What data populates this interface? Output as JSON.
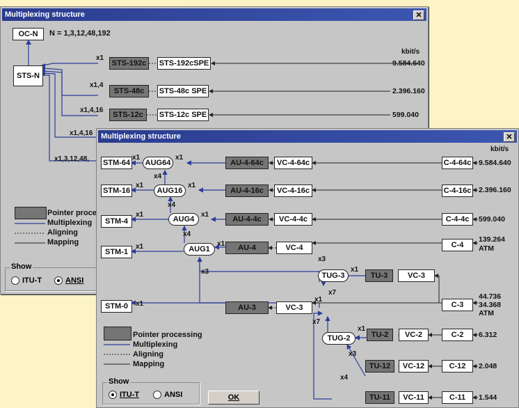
{
  "back": {
    "title": "Multiplexing structure",
    "ocn": "OC-N",
    "n_values": "N = 1,3,12,48,192",
    "stsn": "STS-N",
    "kbits": "kbit/s",
    "rows": [
      {
        "mult": "x1",
        "sts": "STS-192c",
        "spe": "STS-192cSPE",
        "rate": "9.584.640"
      },
      {
        "mult": "x1,4",
        "sts": "STS-48c",
        "spe": "STS-48c SPE",
        "rate": "2.396.160"
      },
      {
        "mult": "x1,4,16",
        "sts": "STS-12c",
        "spe": "STS-12c SPE",
        "rate": "599.040"
      },
      {
        "mult": "x1,4,16",
        "sts": "",
        "spe": "",
        "rate": ""
      },
      {
        "mult": "x1,3,12,48,",
        "sts": "",
        "spe": "",
        "rate": ""
      }
    ],
    "legend": {
      "pointer": "Pointer proces",
      "mux": "Multiplexing",
      "align": "Aligning",
      "map": "Mapping"
    },
    "show": {
      "caption": "Show",
      "itut": "ITU-T",
      "ansi": "ANSI",
      "selected": "ANSI"
    }
  },
  "front": {
    "title": "Multiplexing structure",
    "kbits": "kbit/s",
    "stm": [
      "STM-64",
      "STM-16",
      "STM-4",
      "STM-1",
      "STM-0"
    ],
    "aug": [
      "AUG64",
      "AUG16",
      "AUG4",
      "AUG1"
    ],
    "au": [
      "AU-4-64c",
      "AU-4-16c",
      "AU-4-4c",
      "AU-4",
      "AU-3"
    ],
    "vc": [
      "VC-4-64c",
      "VC-4-16c",
      "VC-4-4c",
      "VC-4",
      "VC-3"
    ],
    "c": [
      "C-4-64c",
      "C-4-16c",
      "C-4-4c",
      "C-4"
    ],
    "rates": [
      "9.584.640",
      "2.396.160",
      "599.040"
    ],
    "c4rate": "139.264",
    "atm": "ATM",
    "tug3": "TUG-3",
    "tu3": "TU-3",
    "vc3b": "VC-3",
    "c3": "C-3",
    "c3rate1": "44.736",
    "c3rate2": "34.368",
    "tug2": "TUG-2",
    "tu2": "TU-2",
    "vc2": "VC-2",
    "c2": "C-2",
    "c2rate": "6.312",
    "tu12": "TU-12",
    "vc12": "VC-12",
    "c12": "C-12",
    "c12rate": "2.048",
    "tu11": "TU-11",
    "vc11": "VC-11",
    "c11": "C-11",
    "c11rate": "1.544",
    "mult": {
      "x1": "x1",
      "x4": "x4",
      "x3": "x3",
      "x7": "x7"
    },
    "legend": {
      "pointer": "Pointer processing",
      "mux": "Multiplexing",
      "align": "Aligning",
      "map": "Mapping"
    },
    "show": {
      "caption": "Show",
      "itut": "ITU-T",
      "ansi": "ANSI",
      "selected": "ITU-T"
    },
    "ok": "OK"
  },
  "colors": {
    "title": "#2a3c8f",
    "pointer_box": "#757575",
    "mux_line": "#2a3c9a",
    "panel": "#c6c6c6",
    "desktop": "#fdf4c6"
  }
}
